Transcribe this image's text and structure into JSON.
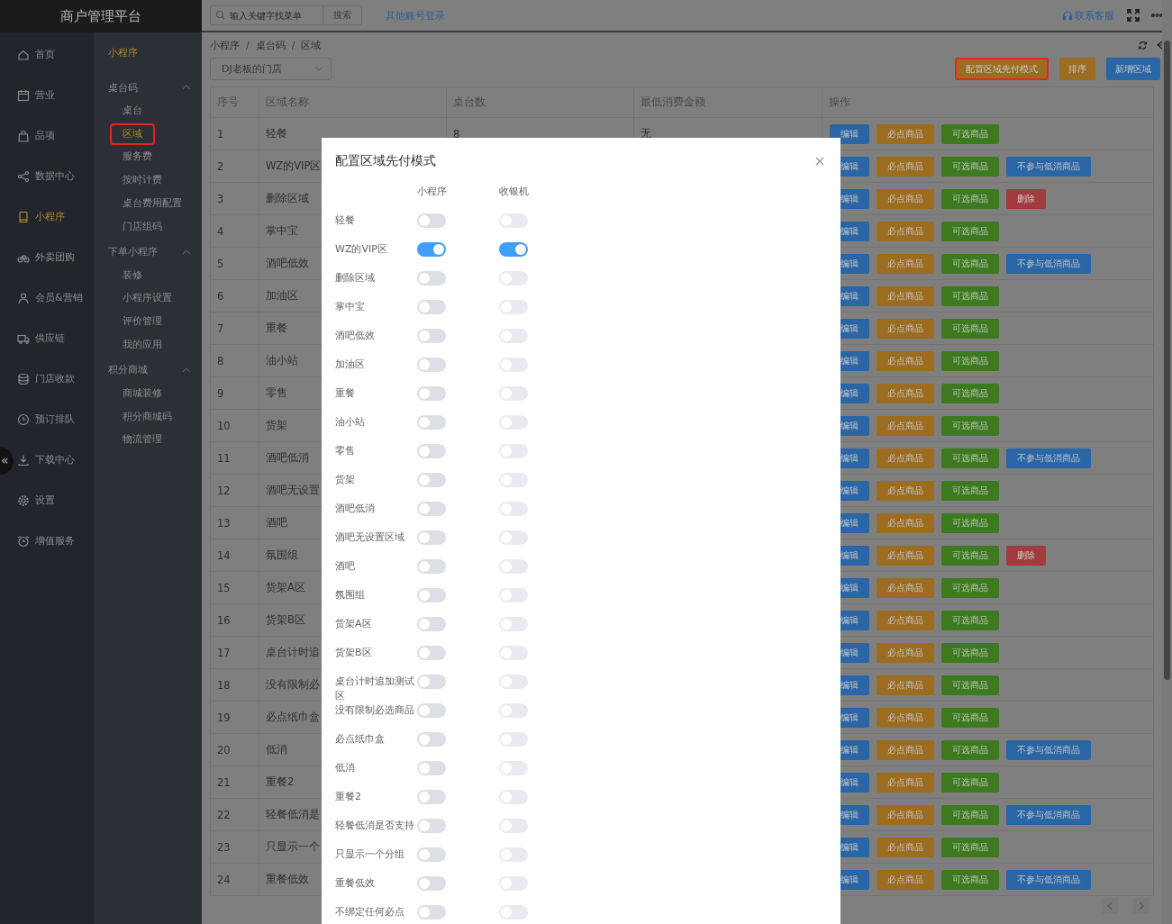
{
  "app": {
    "title": "商户管理平台"
  },
  "topbar": {
    "search": {
      "placeholder": "输入关键字找菜单"
    },
    "search_button": "搜索",
    "link": "其他账号登录",
    "support": "联系客服"
  },
  "nav": [
    {
      "label": "首页",
      "selected": false
    },
    {
      "label": "营业",
      "selected": false
    },
    {
      "label": "品项",
      "selected": false
    },
    {
      "label": "数据中心",
      "selected": false
    },
    {
      "label": "小程序",
      "selected": true
    },
    {
      "label": "外卖团购",
      "selected": false
    },
    {
      "label": "会员&营销",
      "selected": false
    },
    {
      "label": "供应链",
      "selected": false
    },
    {
      "label": "门店收款",
      "selected": false
    },
    {
      "label": "预订排队",
      "selected": false
    },
    {
      "label": "下载中心",
      "selected": false
    },
    {
      "label": "设置",
      "selected": false
    },
    {
      "label": "增值服务",
      "selected": false
    }
  ],
  "collapse_button": "«",
  "subnav": {
    "title": "小程序",
    "groups": [
      {
        "label": "桌台码",
        "expanded": true,
        "children": [
          {
            "label": "桌台",
            "selected": false,
            "highlighted": false
          },
          {
            "label": "区域",
            "selected": true,
            "highlighted": true
          },
          {
            "label": "服务费",
            "selected": false,
            "highlighted": false
          },
          {
            "label": "按时计费",
            "selected": false,
            "highlighted": false
          },
          {
            "label": "桌台费用配置",
            "selected": false,
            "highlighted": false
          },
          {
            "label": "门店组码",
            "selected": false,
            "highlighted": false
          }
        ]
      },
      {
        "label": "下单小程序",
        "expanded": true,
        "children": [
          {
            "label": "装修",
            "selected": false,
            "highlighted": false
          },
          {
            "label": "小程序设置",
            "selected": false,
            "highlighted": false
          },
          {
            "label": "评价管理",
            "selected": false,
            "highlighted": false
          },
          {
            "label": "我的应用",
            "selected": false,
            "highlighted": false
          }
        ]
      },
      {
        "label": "积分商城",
        "expanded": true,
        "children": [
          {
            "label": "商城装修",
            "selected": false,
            "highlighted": false
          },
          {
            "label": "积分商城码",
            "selected": false,
            "highlighted": false
          },
          {
            "label": "物流管理",
            "selected": false,
            "highlighted": false
          }
        ]
      }
    ]
  },
  "breadcrumb": {
    "items": [
      "小程序",
      "桌台码",
      "区域"
    ],
    "separator": "/"
  },
  "store_select": {
    "value": "DJ老板的门店"
  },
  "actions": [
    {
      "label": "配置区域先付模式",
      "kind": "warning",
      "highlighted": true
    },
    {
      "label": "排序",
      "kind": "warning",
      "highlighted": false
    },
    {
      "label": "新增区域",
      "kind": "primary",
      "highlighted": false
    }
  ],
  "table": {
    "columns": [
      "序号",
      "区域名称",
      "桌台数",
      "最低消费金额",
      "操作"
    ],
    "rows": [
      {
        "no": "1",
        "name": "轻餐",
        "tables": "8",
        "min_spend": "无",
        "actions": [
          {
            "label": "编辑",
            "kind": "primary"
          },
          {
            "label": "必点商品",
            "kind": "warning"
          },
          {
            "label": "可选商品",
            "kind": "success"
          }
        ]
      },
      {
        "no": "2",
        "name": "WZ的VIP区",
        "actions": [
          {
            "label": "编辑",
            "kind": "primary"
          },
          {
            "label": "必点商品",
            "kind": "warning"
          },
          {
            "label": "可选商品",
            "kind": "success"
          },
          {
            "label": "不参与低消商品",
            "kind": "primary"
          }
        ]
      },
      {
        "no": "3",
        "name": "删除区域",
        "actions": [
          {
            "label": "编辑",
            "kind": "primary"
          },
          {
            "label": "必点商品",
            "kind": "warning"
          },
          {
            "label": "可选商品",
            "kind": "success"
          },
          {
            "label": "删除",
            "kind": "danger"
          }
        ]
      },
      {
        "no": "4",
        "name": "掌中宝",
        "actions": [
          {
            "label": "编辑",
            "kind": "primary"
          },
          {
            "label": "必点商品",
            "kind": "warning"
          },
          {
            "label": "可选商品",
            "kind": "success"
          }
        ]
      },
      {
        "no": "5",
        "name": "酒吧低效",
        "actions": [
          {
            "label": "编辑",
            "kind": "primary"
          },
          {
            "label": "必点商品",
            "kind": "warning"
          },
          {
            "label": "可选商品",
            "kind": "success"
          },
          {
            "label": "不参与低消商品",
            "kind": "primary"
          }
        ]
      },
      {
        "no": "6",
        "name": "加油区",
        "actions": [
          {
            "label": "编辑",
            "kind": "primary"
          },
          {
            "label": "必点商品",
            "kind": "warning"
          },
          {
            "label": "可选商品",
            "kind": "success"
          }
        ]
      },
      {
        "no": "7",
        "name": "重餐",
        "actions": [
          {
            "label": "编辑",
            "kind": "primary"
          },
          {
            "label": "必点商品",
            "kind": "warning"
          },
          {
            "label": "可选商品",
            "kind": "success"
          }
        ]
      },
      {
        "no": "8",
        "name": "油小站",
        "actions": [
          {
            "label": "编辑",
            "kind": "primary"
          },
          {
            "label": "必点商品",
            "kind": "warning"
          },
          {
            "label": "可选商品",
            "kind": "success"
          }
        ]
      },
      {
        "no": "9",
        "name": "零售",
        "actions": [
          {
            "label": "编辑",
            "kind": "primary"
          },
          {
            "label": "必点商品",
            "kind": "warning"
          },
          {
            "label": "可选商品",
            "kind": "success"
          }
        ]
      },
      {
        "no": "10",
        "name": "货架",
        "actions": [
          {
            "label": "编辑",
            "kind": "primary"
          },
          {
            "label": "必点商品",
            "kind": "warning"
          },
          {
            "label": "可选商品",
            "kind": "success"
          }
        ]
      },
      {
        "no": "11",
        "name": "酒吧低消",
        "actions": [
          {
            "label": "编辑",
            "kind": "primary"
          },
          {
            "label": "必点商品",
            "kind": "warning"
          },
          {
            "label": "可选商品",
            "kind": "success"
          },
          {
            "label": "不参与低消商品",
            "kind": "primary"
          }
        ]
      },
      {
        "no": "12",
        "name": "酒吧无设置",
        "actions": [
          {
            "label": "编辑",
            "kind": "primary"
          },
          {
            "label": "必点商品",
            "kind": "warning"
          },
          {
            "label": "可选商品",
            "kind": "success"
          }
        ]
      },
      {
        "no": "13",
        "name": "酒吧",
        "actions": [
          {
            "label": "编辑",
            "kind": "primary"
          },
          {
            "label": "必点商品",
            "kind": "warning"
          },
          {
            "label": "可选商品",
            "kind": "success"
          }
        ]
      },
      {
        "no": "14",
        "name": "氛围组",
        "actions": [
          {
            "label": "编辑",
            "kind": "primary"
          },
          {
            "label": "必点商品",
            "kind": "warning"
          },
          {
            "label": "可选商品",
            "kind": "success"
          },
          {
            "label": "删除",
            "kind": "danger"
          }
        ]
      },
      {
        "no": "15",
        "name": "货架A区",
        "actions": [
          {
            "label": "编辑",
            "kind": "primary"
          },
          {
            "label": "必点商品",
            "kind": "warning"
          },
          {
            "label": "可选商品",
            "kind": "success"
          }
        ]
      },
      {
        "no": "16",
        "name": "货架B区",
        "actions": [
          {
            "label": "编辑",
            "kind": "primary"
          },
          {
            "label": "必点商品",
            "kind": "warning"
          },
          {
            "label": "可选商品",
            "kind": "success"
          }
        ]
      },
      {
        "no": "17",
        "name": "桌台计时追",
        "actions": [
          {
            "label": "编辑",
            "kind": "primary"
          },
          {
            "label": "必点商品",
            "kind": "warning"
          },
          {
            "label": "可选商品",
            "kind": "success"
          }
        ]
      },
      {
        "no": "18",
        "name": "没有限制必",
        "actions": [
          {
            "label": "编辑",
            "kind": "primary"
          },
          {
            "label": "必点商品",
            "kind": "warning"
          },
          {
            "label": "可选商品",
            "kind": "success"
          }
        ]
      },
      {
        "no": "19",
        "name": "必点纸巾盒",
        "actions": [
          {
            "label": "编辑",
            "kind": "primary"
          },
          {
            "label": "必点商品",
            "kind": "warning"
          },
          {
            "label": "可选商品",
            "kind": "success"
          }
        ]
      },
      {
        "no": "20",
        "name": "低消",
        "actions": [
          {
            "label": "编辑",
            "kind": "primary"
          },
          {
            "label": "必点商品",
            "kind": "warning"
          },
          {
            "label": "可选商品",
            "kind": "success"
          },
          {
            "label": "不参与低消商品",
            "kind": "primary"
          }
        ]
      },
      {
        "no": "21",
        "name": "重餐2",
        "actions": [
          {
            "label": "编辑",
            "kind": "primary"
          },
          {
            "label": "必点商品",
            "kind": "warning"
          },
          {
            "label": "可选商品",
            "kind": "success"
          }
        ]
      },
      {
        "no": "22",
        "name": "轻餐低消是",
        "actions": [
          {
            "label": "编辑",
            "kind": "primary"
          },
          {
            "label": "必点商品",
            "kind": "warning"
          },
          {
            "label": "可选商品",
            "kind": "success"
          },
          {
            "label": "不参与低消商品",
            "kind": "primary"
          }
        ]
      },
      {
        "no": "23",
        "name": "只显示一个",
        "actions": [
          {
            "label": "编辑",
            "kind": "primary"
          },
          {
            "label": "必点商品",
            "kind": "warning"
          },
          {
            "label": "可选商品",
            "kind": "success"
          }
        ]
      },
      {
        "no": "24",
        "name": "重餐低效",
        "actions": [
          {
            "label": "编辑",
            "kind": "primary"
          },
          {
            "label": "必点商品",
            "kind": "warning"
          },
          {
            "label": "可选商品",
            "kind": "success"
          },
          {
            "label": "不参与低消商品",
            "kind": "primary"
          }
        ]
      }
    ]
  },
  "modal": {
    "title": "配置区域先付模式",
    "columns": [
      "小程序",
      "收银机"
    ],
    "rows": [
      {
        "name": "轻餐",
        "mini_program": false,
        "cashier": false
      },
      {
        "name": "WZ的VIP区",
        "mini_program": true,
        "cashier": true
      },
      {
        "name": "删除区域",
        "mini_program": false,
        "cashier": false
      },
      {
        "name": "掌中宝",
        "mini_program": false,
        "cashier": false
      },
      {
        "name": "酒吧低效",
        "mini_program": false,
        "cashier": false
      },
      {
        "name": "加油区",
        "mini_program": false,
        "cashier": false
      },
      {
        "name": "重餐",
        "mini_program": false,
        "cashier": false
      },
      {
        "name": "油小站",
        "mini_program": false,
        "cashier": false
      },
      {
        "name": "零售",
        "mini_program": false,
        "cashier": false
      },
      {
        "name": "货架",
        "mini_program": false,
        "cashier": false
      },
      {
        "name": "酒吧低消",
        "mini_program": false,
        "cashier": false
      },
      {
        "name": "酒吧无设置区域",
        "mini_program": false,
        "cashier": false
      },
      {
        "name": "酒吧",
        "mini_program": false,
        "cashier": false
      },
      {
        "name": "氛围组",
        "mini_program": false,
        "cashier": false
      },
      {
        "name": "货架A区",
        "mini_program": false,
        "cashier": false
      },
      {
        "name": "货架B区",
        "mini_program": false,
        "cashier": false
      },
      {
        "name": "桌台计时追加测试区",
        "mini_program": false,
        "cashier": false
      },
      {
        "name": "没有限制必选商品",
        "mini_program": false,
        "cashier": false
      },
      {
        "name": "必点纸巾盒",
        "mini_program": false,
        "cashier": false
      },
      {
        "name": "低消",
        "mini_program": false,
        "cashier": false
      },
      {
        "name": "重餐2",
        "mini_program": false,
        "cashier": false
      },
      {
        "name": "轻餐低消是否支持",
        "mini_program": false,
        "cashier": false
      },
      {
        "name": "只显示一个分组",
        "mini_program": false,
        "cashier": false
      },
      {
        "name": "重餐低效",
        "mini_program": false,
        "cashier": false
      },
      {
        "name": "不绑定任何必点",
        "mini_program": false,
        "cashier": false
      }
    ]
  }
}
